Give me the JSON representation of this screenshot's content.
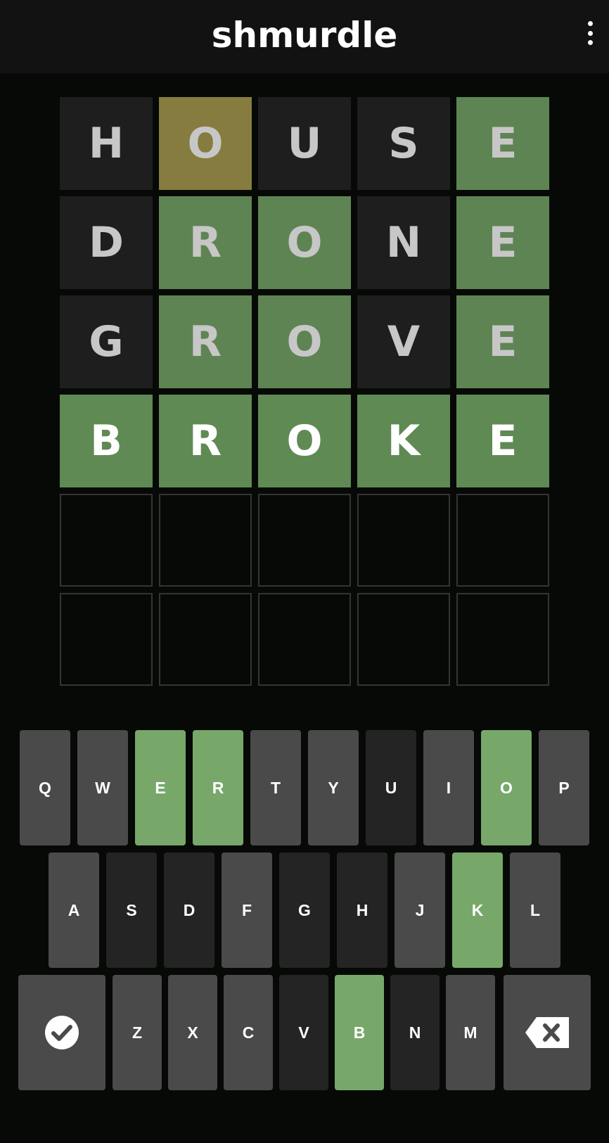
{
  "header": {
    "title": "shmurdle",
    "menu_icon": "vertical-dots-icon"
  },
  "board": {
    "rows": [
      {
        "letters": [
          "H",
          "O",
          "U",
          "S",
          "E"
        ],
        "states": [
          "absent",
          "present",
          "absent",
          "absent",
          "correct"
        ]
      },
      {
        "letters": [
          "D",
          "R",
          "O",
          "N",
          "E"
        ],
        "states": [
          "absent",
          "correct",
          "correct",
          "absent",
          "correct"
        ]
      },
      {
        "letters": [
          "G",
          "R",
          "O",
          "V",
          "E"
        ],
        "states": [
          "absent",
          "correct",
          "correct",
          "absent",
          "correct"
        ]
      },
      {
        "letters": [
          "B",
          "R",
          "O",
          "K",
          "E"
        ],
        "states": [
          "solved",
          "solved",
          "solved",
          "solved",
          "solved"
        ]
      },
      {
        "letters": [
          "",
          "",
          "",
          "",
          ""
        ],
        "states": [
          "empty",
          "empty",
          "empty",
          "empty",
          "empty"
        ]
      },
      {
        "letters": [
          "",
          "",
          "",
          "",
          ""
        ],
        "states": [
          "empty",
          "empty",
          "empty",
          "empty",
          "empty"
        ]
      }
    ]
  },
  "keyboard": {
    "row1": [
      {
        "label": "Q",
        "state": "unused"
      },
      {
        "label": "W",
        "state": "unused"
      },
      {
        "label": "E",
        "state": "correct"
      },
      {
        "label": "R",
        "state": "correct"
      },
      {
        "label": "T",
        "state": "unused"
      },
      {
        "label": "Y",
        "state": "unused"
      },
      {
        "label": "U",
        "state": "absent"
      },
      {
        "label": "I",
        "state": "unused"
      },
      {
        "label": "O",
        "state": "correct"
      },
      {
        "label": "P",
        "state": "unused"
      }
    ],
    "row2": [
      {
        "label": "A",
        "state": "unused"
      },
      {
        "label": "S",
        "state": "absent"
      },
      {
        "label": "D",
        "state": "absent"
      },
      {
        "label": "F",
        "state": "unused"
      },
      {
        "label": "G",
        "state": "absent"
      },
      {
        "label": "H",
        "state": "absent"
      },
      {
        "label": "J",
        "state": "unused"
      },
      {
        "label": "K",
        "state": "correct"
      },
      {
        "label": "L",
        "state": "unused"
      }
    ],
    "row3": [
      {
        "label": "Z",
        "state": "unused"
      },
      {
        "label": "X",
        "state": "unused"
      },
      {
        "label": "C",
        "state": "unused"
      },
      {
        "label": "V",
        "state": "absent"
      },
      {
        "label": "B",
        "state": "correct"
      },
      {
        "label": "N",
        "state": "absent"
      },
      {
        "label": "M",
        "state": "unused"
      }
    ],
    "enter_icon": "checkmark-circle-icon",
    "backspace_icon": "backspace-icon"
  },
  "colors": {
    "background": "#070907",
    "header": "#121212",
    "tile_absent": "#1e1e1e",
    "tile_present": "#877c3f",
    "tile_correct": "#5f8453",
    "key_unused": "#4a4a4a",
    "key_absent": "#242424",
    "key_correct": "#77a86a"
  }
}
